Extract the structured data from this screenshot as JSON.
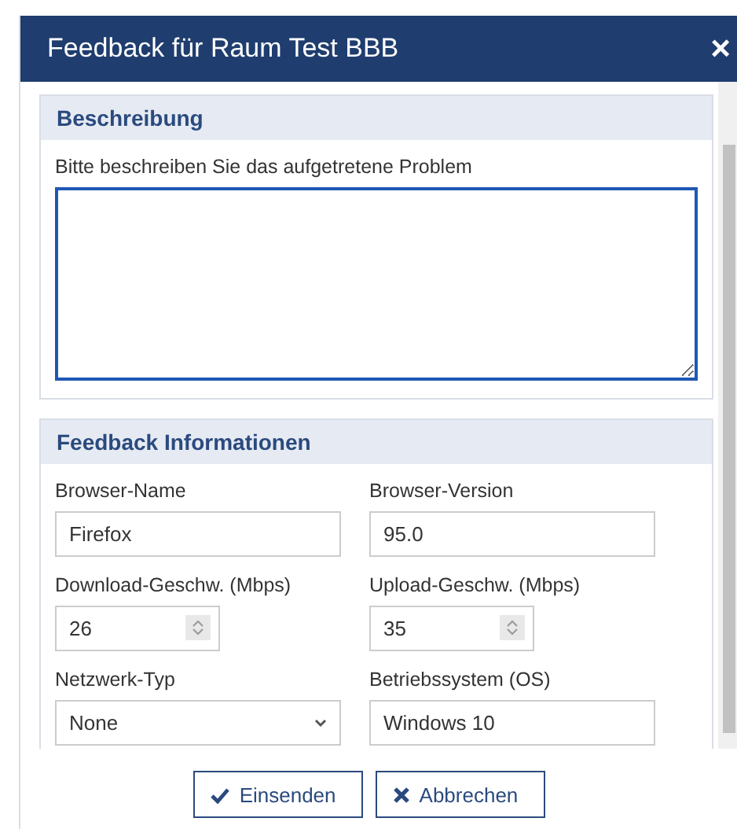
{
  "dialog": {
    "title": "Feedback für Raum Test BBB",
    "close": "×"
  },
  "description": {
    "heading": "Beschreibung",
    "label": "Bitte beschreiben Sie das aufgetretene Problem",
    "focused": true
  },
  "info": {
    "heading": "Feedback Informationen",
    "fields": [
      {
        "kind": "text",
        "label": "Browser-Name",
        "value": "Firefox"
      },
      {
        "kind": "text",
        "label": "Browser-Version",
        "value": "95.0"
      },
      {
        "kind": "number",
        "label": "Download-Geschw. (Mbps)",
        "value": "26"
      },
      {
        "kind": "number",
        "label": "Upload-Geschw. (Mbps)",
        "value": "35"
      },
      {
        "kind": "select",
        "label": "Netzwerk-Typ",
        "value": "None"
      },
      {
        "kind": "text",
        "label": "Betriebssystem (OS)",
        "value": "Windows 10"
      }
    ]
  },
  "buttons": [
    {
      "kind": "submit",
      "label": "Einsenden"
    },
    {
      "kind": "cancel",
      "label": "Abbrechen"
    }
  ]
}
